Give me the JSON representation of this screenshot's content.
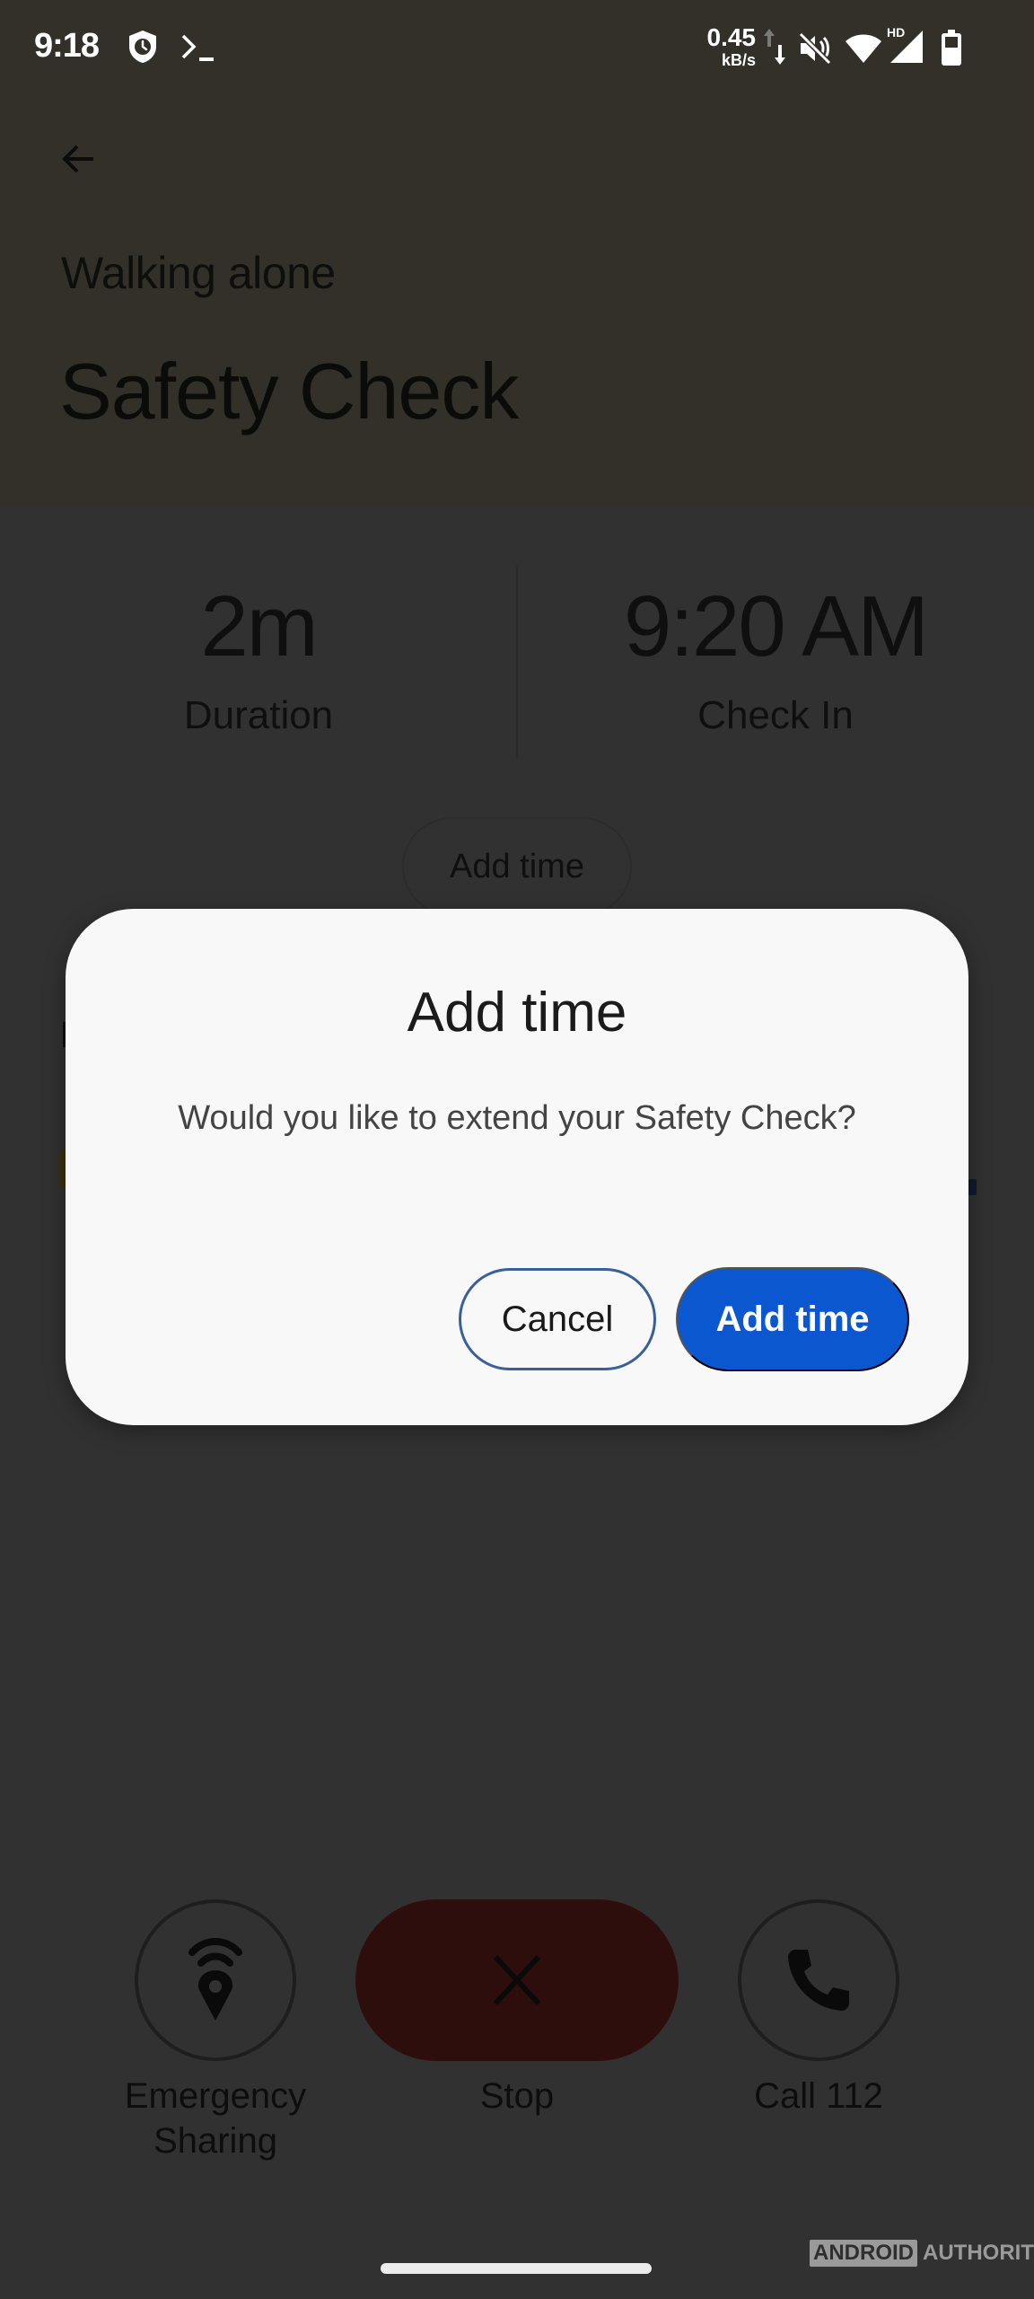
{
  "status_bar": {
    "time": "9:18",
    "net_speed_value": "0.45",
    "net_speed_unit": "kB/s",
    "signal_label": "HD",
    "icons": [
      "shield-clock-icon",
      "terminal-icon",
      "data-arrows-icon",
      "mute-icon",
      "wifi-icon",
      "cell-signal-icon",
      "battery-icon"
    ]
  },
  "header": {
    "back_icon": "arrow-left-icon",
    "subtitle": "Walking alone",
    "title": "Safety Check"
  },
  "stats": {
    "duration_value": "2m",
    "duration_label": "Duration",
    "checkin_value": "9:20 AM",
    "checkin_label": "Check In"
  },
  "background_add_time_label": "Add time",
  "dialog": {
    "title": "Add time",
    "message": "Would you like to extend your Safety Check?",
    "cancel_label": "Cancel",
    "confirm_label": "Add time",
    "confirm_color": "#0b57d0"
  },
  "actions": [
    {
      "label": "Emergency Sharing",
      "icon": "location-broadcast-icon"
    },
    {
      "label": "Stop",
      "icon": "close-icon"
    },
    {
      "label": "Call 112",
      "icon": "phone-icon"
    }
  ],
  "watermark": {
    "boxed": "ANDROID",
    "text": "AUTHORITY"
  }
}
